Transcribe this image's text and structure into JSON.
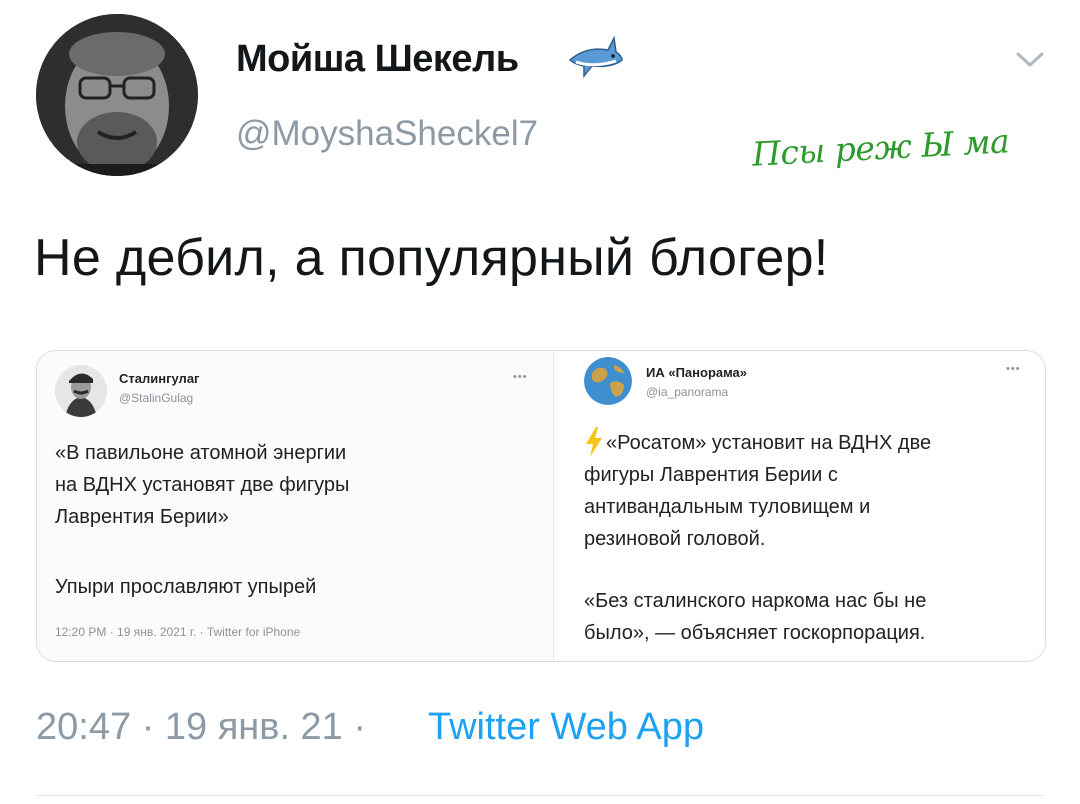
{
  "tweet": {
    "display_name": "Мойша Шекель",
    "handle": "@MoyshaSheckel7",
    "text": "Не дебил, а популярный блогер!",
    "time": "20:47 · 19 янв. 21 ·",
    "source": "Twitter Web App"
  },
  "watermark": "Псы реж Ы ма",
  "quote_left": {
    "name": "Сталингулаг",
    "handle": "@StalinGulag",
    "more": "•••",
    "line1": "«В павильоне атомной энергии",
    "line2": "на ВДНХ установят две фигуры",
    "line3": "Лаврентия Берии»",
    "line4": "Упыри прославляют упырей",
    "meta": "12:20 PM · 19 янв. 2021 г. · Twitter for iPhone"
  },
  "quote_right": {
    "name": "ИА «Панорама»",
    "handle": "@ia_panorama",
    "more": "•••",
    "line1": "«Росатом» установит на ВДНХ две",
    "line2": "фигуры Лаврентия Берии с",
    "line3": "антивандальным туловищем и",
    "line4": "резиновой головой.",
    "line5": "«Без сталинского наркома нас бы не",
    "line6": "было», — объясняет госкорпорация."
  },
  "colors": {
    "text": "#14171a",
    "secondary": "#8d99a4",
    "link": "#1da1f2",
    "watermark": "#2f9a2c",
    "lightning": "#f5c518"
  },
  "icons": {
    "verified_like": "shark-icon",
    "menu": "chevron-down-icon",
    "bolt": "lightning-icon"
  }
}
